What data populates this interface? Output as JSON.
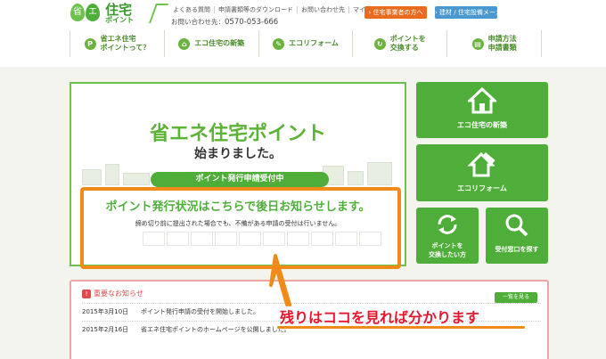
{
  "header": {
    "logo": {
      "leaf1": "省",
      "leaf2": "エネ",
      "main": "住宅",
      "sub": "ポイント"
    },
    "top_links": [
      "よくある質問",
      "申請書類等のダウンロード",
      "お問い合わせ先",
      "マイページ"
    ],
    "phone_label": "お問い合わせ先：",
    "phone_number": "0570-053-666",
    "btn_business": "住宅事業者の方へ",
    "btn_maker": "建材 / 住宅設備メーカーの方へ",
    "colors": {
      "orange": "#ea6b1d",
      "blue": "#4a98cf",
      "green": "#4fae3a"
    }
  },
  "nav": [
    {
      "icon": "P",
      "icon_name": "points-icon",
      "label": "省エネ住宅\nポイントって？"
    },
    {
      "icon": "⌂",
      "icon_name": "house-icon",
      "label": "エコ住宅の新築"
    },
    {
      "icon": "✎",
      "icon_name": "hammer-icon",
      "label": "エコリフォーム"
    },
    {
      "icon": "↻",
      "icon_name": "exchange-icon",
      "label": "ポイントを\n交換する"
    },
    {
      "icon": "▤",
      "icon_name": "document-icon",
      "label": "申請方法\n申請書類"
    }
  ],
  "hero": {
    "title": "省エネ住宅ポイント",
    "subtitle": "始まりました。",
    "pill": "ポイント発行申請受付中",
    "notice_main": "ポイント発行状況はこちらで後日お知らせします。",
    "notice_small": "締め切り前に提出された場合でも、不備がある申請の受付は行いません。"
  },
  "tiles": {
    "eco": "エコ住宅の新築",
    "reform": "エコリフォーム",
    "exchange_line1": "ポイントを",
    "exchange_line2": "交換したい方",
    "desk": "受付窓口を探す"
  },
  "news": {
    "heading": "重要なお知らせ",
    "more": "一覧を見る",
    "items": [
      {
        "date": "2015年3月10日",
        "text": "ポイント発行申請の受付を開始しました。"
      },
      {
        "date": "2015年2月16日",
        "text": "省エネ住宅ポイントのホームページを公開しました。"
      }
    ]
  },
  "annotation": {
    "text": "残りはココを見れば分かります",
    "color": "#e8172d",
    "box_color": "#f08a18"
  }
}
